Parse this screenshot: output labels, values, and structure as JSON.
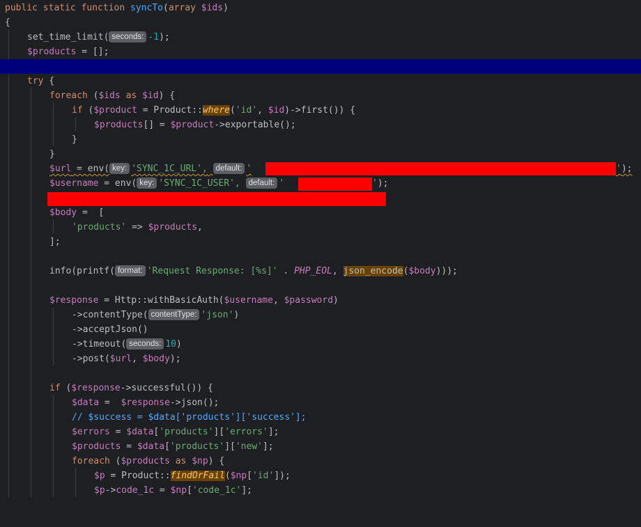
{
  "editor": {
    "lines": {
      "l1": {
        "kw1": "public static function ",
        "name": "syncTo",
        "p1": "(",
        "kw2": "array ",
        "arg": "$ids",
        "p2": ")"
      },
      "l2": {
        "t": "{"
      },
      "l3": {
        "fn": "set_time_limit",
        "p1": "(",
        "hint": "seconds:",
        "num": "-1",
        "p2": ");"
      },
      "l4": {
        "var": "$products",
        "rest": " = [];"
      },
      "l6": {
        "kw": "try",
        "rest": " {"
      },
      "l7": {
        "kw1": "foreach",
        "p1": " (",
        "v1": "$ids",
        "kw2": " as ",
        "v2": "$id",
        "p2": ") {"
      },
      "l8": {
        "kw": "if",
        "p1": " (",
        "v1": "$product",
        "p2": " = Product::",
        "m": "where",
        "p3": "(",
        "s1": "'id'",
        "p4": ", ",
        "v2": "$id",
        "p5": ")->",
        "fn": "first",
        "p6": "()) {"
      },
      "l9": {
        "v1": "$products",
        "p1": "[] = ",
        "v2": "$product",
        "p2": "->",
        "fn": "exportable",
        "p3": "();"
      },
      "l10": {
        "t": "}"
      },
      "l11": {
        "t": "}"
      },
      "l12": {
        "v": "$url",
        "p1": " = env(",
        "h1": "key:",
        "s1": "'SYNC_1C_URL',",
        "h2": "default:",
        "s2": "'",
        "s3": "'",
        "p2": ");"
      },
      "l13": {
        "v": "$username",
        "p1": " = env(",
        "h1": "key:",
        "s1": "'SYNC_1C_USER',",
        "h2": "default:",
        "s2": "'",
        "s3": "'",
        "p2": ");"
      },
      "l15": {
        "v": "$body",
        "p1": " =  ["
      },
      "l16": {
        "s": "'products'",
        "p1": " => ",
        "v": "$products",
        "p2": ","
      },
      "l17": {
        "t": "];"
      },
      "l19": {
        "fn1": "info",
        "p1": "(",
        "fn2": "printf",
        "p2": "(",
        "h": "format:",
        "s": "'Request Response: [%s]'",
        "p3": " . ",
        "c": "PHP_EOL",
        "p4": ", ",
        "fn3": "json_encode",
        "p5": "(",
        "v": "$body",
        "p6": ")));"
      },
      "l21": {
        "v1": "$response",
        "p1": " = Http::",
        "fn": "withBasicAuth",
        "p2": "(",
        "v2": "$username",
        "p3": ", ",
        "v3": "$password",
        "p4": ")"
      },
      "l22": {
        "p1": "->",
        "fn": "contentType",
        "p2": "(",
        "h": "contentType:",
        "s": "'json'",
        "p3": ")"
      },
      "l23": {
        "p1": "->",
        "fn": "acceptJson",
        "p2": "()"
      },
      "l24": {
        "p1": "->",
        "fn": "timeout",
        "p2": "(",
        "h": "seconds:",
        "num": "10",
        "p3": ")"
      },
      "l25": {
        "p1": "->",
        "fn": "post",
        "p2": "(",
        "v1": "$url",
        "p3": ", ",
        "v2": "$body",
        "p4": ");"
      },
      "l27": {
        "kw": "if",
        "p1": " (",
        "v": "$response",
        "p2": "->",
        "fn": "successful",
        "p3": "()) {"
      },
      "l28": {
        "v1": "$data",
        "p1": " =  ",
        "v2": "$response",
        "p2": "->",
        "fn": "json",
        "p3": "();"
      },
      "l29": {
        "c": "// $success = $data['products']['success'];"
      },
      "l30": {
        "v1": "$errors",
        "p1": " = ",
        "v2": "$data",
        "p2": "[",
        "s1": "'products'",
        "p3": "][",
        "s2": "'errors'",
        "p4": "];"
      },
      "l31": {
        "v1": "$products",
        "p1": " = ",
        "v2": "$data",
        "p2": "[",
        "s1": "'products'",
        "p3": "][",
        "s2": "'new'",
        "p4": "];"
      },
      "l32": {
        "kw1": "foreach",
        "p1": " (",
        "v1": "$products",
        "kw2": " as ",
        "v2": "$np",
        "p2": ") {"
      },
      "l33": {
        "v1": "$p",
        "p1": " = Product::",
        "m": "findOrFail",
        "p2": "(",
        "v2": "$np",
        "p3": "[",
        "s": "'id'",
        "p4": "]);"
      },
      "l34": {
        "v1": "$p",
        "p1": "->",
        "f": "code_1c",
        "p2": " = ",
        "v2": "$np",
        "p3": "[",
        "s": "'code_1c'",
        "p4": "];"
      }
    }
  }
}
